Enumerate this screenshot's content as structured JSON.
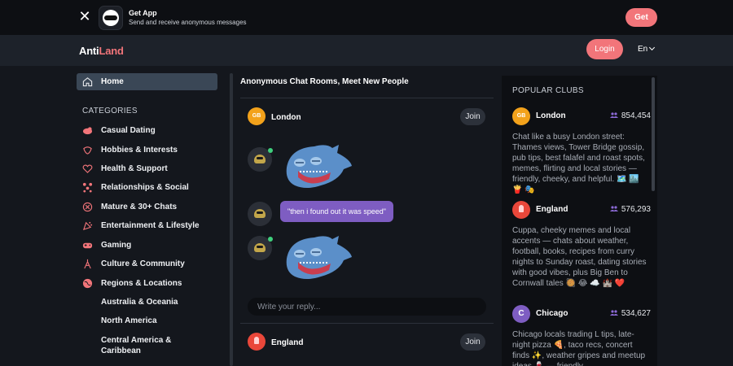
{
  "banner": {
    "title": "Get App",
    "subtitle": "Send and receive anonymous messages",
    "get_label": "Get"
  },
  "header": {
    "logo_part1": "Anti",
    "logo_part2": "Land",
    "login_label": "Login",
    "language": "En"
  },
  "sidebar": {
    "home_label": "Home",
    "categories_heading": "CATEGORIES",
    "categories": [
      {
        "label": "Casual Dating",
        "icon": "casual-dating-icon"
      },
      {
        "label": "Hobbies & Interests",
        "icon": "hobbies-icon"
      },
      {
        "label": "Health & Support",
        "icon": "heart-icon"
      },
      {
        "label": "Relationships & Social",
        "icon": "relationships-icon"
      },
      {
        "label": "Mature & 30+ Chats",
        "icon": "mature-icon"
      },
      {
        "label": "Entertainment & Lifestyle",
        "icon": "party-icon"
      },
      {
        "label": "Gaming",
        "icon": "gamepad-icon"
      },
      {
        "label": "Culture & Community",
        "icon": "culture-icon"
      },
      {
        "label": "Regions & Locations",
        "icon": "globe-icon"
      }
    ],
    "subcategories": [
      "Australia & Oceania",
      "North America",
      "Central America & Caribbean"
    ]
  },
  "feed": {
    "title": "Anonymous Chat Rooms, Meet New People",
    "rooms": [
      {
        "name": "London",
        "badge": "GB",
        "join_label": "Join"
      },
      {
        "name": "England",
        "join_label": "Join"
      }
    ],
    "message_text": "\"then i found out it was speed\"",
    "reply_placeholder": "Write your reply..."
  },
  "clubs": {
    "heading": "POPULAR CLUBS",
    "items": [
      {
        "name": "London",
        "badge": "GB",
        "count": "854,454",
        "description": "Chat like a busy London street: Thames views, Tower Bridge gossip, pub tips, best falafel and roast spots, memes, flirting and local stories — friendly, cheeky, and helpful. 🗺️ 🏙️ 🍟 🎭"
      },
      {
        "name": "England",
        "count": "576,293",
        "description": "Cuppa, cheeky memes and local accents — chats about weather, football, books, recipes from curry nights to Sunday roast, dating stories with good vibes, plus Big Ben to Cornwall tales 🥘 😂 ☁️ 🏰 ❤️"
      },
      {
        "name": "Chicago",
        "badge": "C",
        "count": "534,627",
        "description": "Chicago locals trading L tips, late-night pizza 🍕, taco recs, concert finds ✨, weather gripes and meetup ideas 🍷 — friendly,"
      }
    ]
  }
}
